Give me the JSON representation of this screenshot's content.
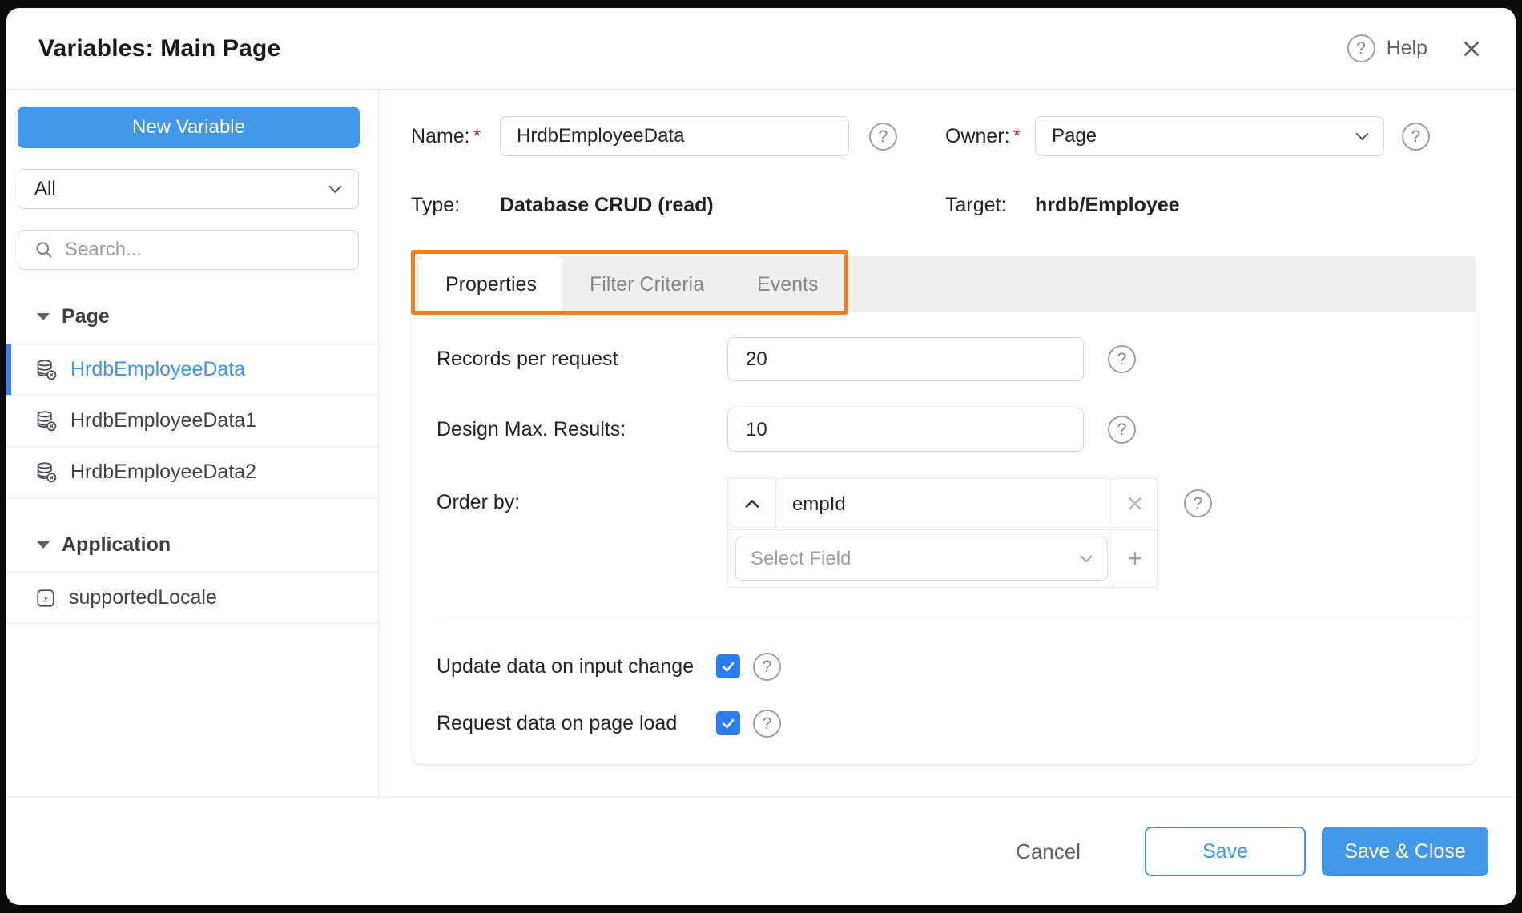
{
  "dialog": {
    "title": "Variables: Main Page",
    "help_label": "Help"
  },
  "icons": {
    "help": "?",
    "remove": "✕",
    "plus": "+"
  },
  "sidebar": {
    "new_variable_label": "New Variable",
    "filter_value": "All",
    "search_placeholder": "Search...",
    "sections": [
      {
        "label": "Page",
        "items": [
          {
            "label": "HrdbEmployeeData",
            "icon": "database-crud-variable-icon",
            "selected": true
          },
          {
            "label": "HrdbEmployeeData1",
            "icon": "database-crud-variable-icon",
            "selected": false
          },
          {
            "label": "HrdbEmployeeData2",
            "icon": "database-crud-variable-icon",
            "selected": false
          }
        ]
      },
      {
        "label": "Application",
        "items": [
          {
            "label": "supportedLocale",
            "icon": "model-variable-icon",
            "selected": false
          }
        ]
      }
    ]
  },
  "form": {
    "required_marker": "*",
    "name_label": "Name:",
    "name_value": "HrdbEmployeeData",
    "owner_label": "Owner:",
    "owner_value": "Page",
    "type_label": "Type:",
    "type_value": "Database CRUD (read)",
    "target_label": "Target:",
    "target_value": "hrdb/Employee"
  },
  "tabs": [
    {
      "label": "Properties",
      "active": true
    },
    {
      "label": "Filter Criteria",
      "active": false
    },
    {
      "label": "Events",
      "active": false
    }
  ],
  "properties": {
    "records_per_request": {
      "label": "Records per request",
      "value": "20"
    },
    "design_max_results": {
      "label": "Design Max. Results:",
      "value": "10"
    },
    "order_by": {
      "label": "Order by:",
      "field_value": "empId",
      "direction": "ascending",
      "select_placeholder": "Select Field"
    },
    "update_on_input": {
      "label": "Update data on input change",
      "checked": true
    },
    "request_on_load": {
      "label": "Request data on page load",
      "checked": true
    }
  },
  "footer": {
    "cancel_label": "Cancel",
    "save_label": "Save",
    "save_close_label": "Save & Close"
  },
  "colors": {
    "accent_blue": "#4397e8",
    "checkbox_blue": "#2b7df0",
    "selected_item_blue": "#4094ea",
    "annotation_orange": "#ee8122"
  }
}
